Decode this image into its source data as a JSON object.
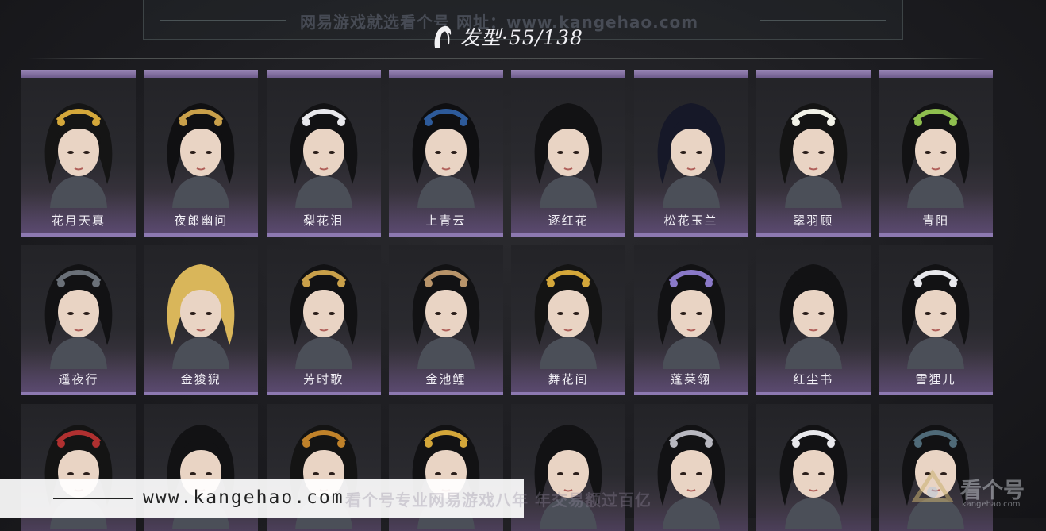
{
  "watermark": {
    "top": "网易游戏就选看个号  网址：www.kangehao.com",
    "bottom": "看个号专业网易游戏八年  年交易额过百亿",
    "url": "www.kangehao.com",
    "logo_text": "看个号",
    "logo_sub": "kangehao.com"
  },
  "header": {
    "title": "发型·55/138",
    "icon": "hair-icon"
  },
  "colors": {
    "accent": "#8d79b1",
    "label": "#f2f0f6"
  },
  "hairstyles": [
    {
      "name": "花月天真",
      "hair": "#151515",
      "accent": "#d4a73a"
    },
    {
      "name": "夜郎幽问",
      "hair": "#101012",
      "accent": "#c9a04a"
    },
    {
      "name": "梨花泪",
      "hair": "#121214",
      "accent": "#e8e8ec"
    },
    {
      "name": "上青云",
      "hair": "#0f0f11",
      "accent": "#2d5a9a"
    },
    {
      "name": "逐红花",
      "hair": "#121214",
      "accent": ""
    },
    {
      "name": "松花玉兰",
      "hair": "#161828",
      "accent": ""
    },
    {
      "name": "翠羽顾",
      "hair": "#141414",
      "accent": "#f2f2e8"
    },
    {
      "name": "青阳",
      "hair": "#121214",
      "accent": "#8fbf4f"
    },
    {
      "name": "遥夜行",
      "hair": "#121214",
      "accent": "#6a7078"
    },
    {
      "name": "金狻猊",
      "hair": "#d9b65a",
      "accent": ""
    },
    {
      "name": "芳时歌",
      "hair": "#121214",
      "accent": "#c9a04a"
    },
    {
      "name": "金池鲤",
      "hair": "#121214",
      "accent": "#b8946a"
    },
    {
      "name": "舞花间",
      "hair": "#141414",
      "accent": "#d4a73a"
    },
    {
      "name": "蓬莱翎",
      "hair": "#121214",
      "accent": "#8a79c8"
    },
    {
      "name": "红尘书",
      "hair": "#121214",
      "accent": ""
    },
    {
      "name": "雪狸儿",
      "hair": "#121214",
      "accent": "#e8e8ec"
    },
    {
      "name": "",
      "hair": "#141414",
      "accent": "#b03030"
    },
    {
      "name": "",
      "hair": "#121214",
      "accent": ""
    },
    {
      "name": "",
      "hair": "#141414",
      "accent": "#c0822a"
    },
    {
      "name": "",
      "hair": "#121214",
      "accent": "#d4a73a"
    },
    {
      "name": "",
      "hair": "#121214",
      "accent": ""
    },
    {
      "name": "",
      "hair": "#121214",
      "accent": "#b8b8c0"
    },
    {
      "name": "",
      "hair": "#121214",
      "accent": "#e8e8ec"
    },
    {
      "name": "",
      "hair": "#121214",
      "accent": "#4f6a78"
    }
  ]
}
